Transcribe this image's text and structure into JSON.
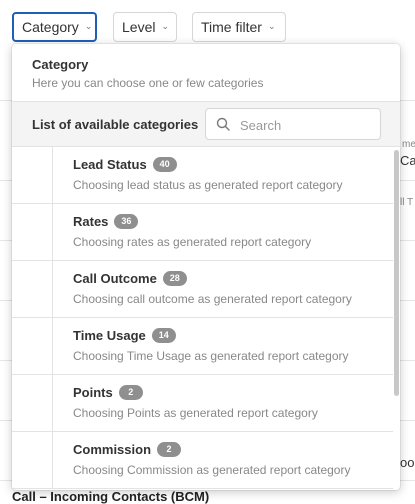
{
  "filters": {
    "category_label": "Category",
    "level_label": "Level",
    "time_label": "Time filter"
  },
  "background": {
    "right_fragments": [
      "me",
      "Cal",
      "ll T",
      "ood"
    ],
    "bottom_row": "Call – Incoming Contacts (BCM)"
  },
  "dropdown": {
    "title": "Category",
    "subtitle": "Here you can choose one or few categories",
    "list_heading": "List of available categories",
    "search_placeholder": "Search",
    "items": [
      {
        "name": "Lead Status",
        "count": "40",
        "description": "Choosing lead status as generated report category"
      },
      {
        "name": "Rates",
        "count": "36",
        "description": "Choosing rates as generated report category"
      },
      {
        "name": "Call Outcome",
        "count": "28",
        "description": "Choosing call outcome as generated report category"
      },
      {
        "name": "Time Usage",
        "count": "14",
        "description": "Choosing Time Usage as generated report category"
      },
      {
        "name": "Points",
        "count": "2",
        "description": "Choosing Points as generated report category"
      },
      {
        "name": "Commission",
        "count": "2",
        "description": "Choosing Commission as generated report category"
      }
    ]
  },
  "colors": {
    "accent_border": "#1f5fb5",
    "badge": "#8f8f8f",
    "muted_text": "#888888"
  }
}
